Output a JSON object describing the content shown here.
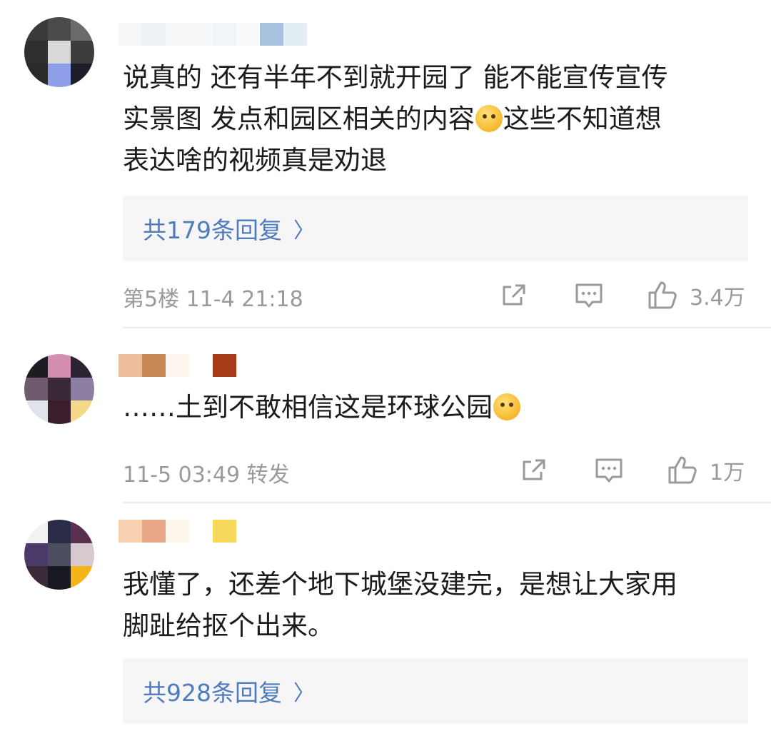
{
  "comments": [
    {
      "text_lines": [
        "说真的 还有半年不到就开园了 能不能宣传宣传",
        "实景图 发点和园区相关的内容",
        "这些不知道想",
        "表达啥的视频真是劝退"
      ],
      "replies_label": "共179条回复",
      "meta": "第5楼 11-4 21:18",
      "likes": "3.4万"
    },
    {
      "text": "……土到不敢相信这是环球公园",
      "meta": "11-5 03:49 转发",
      "likes": "1万"
    },
    {
      "text_lines": [
        "我懂了，还差个地下城堡没建完，是想让大家用",
        "脚趾给抠个出来。"
      ],
      "replies_label": "共928条回复"
    }
  ],
  "icons": {
    "share": "share-icon",
    "comment": "comment-icon",
    "like": "like-icon",
    "chevron": "chevron-right-icon"
  },
  "colors": {
    "link": "#4f7cbf",
    "meta": "#9a9a9a",
    "reply_bg": "#f6f6f6"
  }
}
